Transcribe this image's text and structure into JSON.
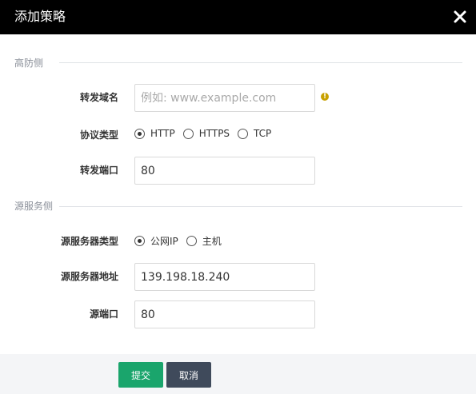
{
  "dialog": {
    "title": "添加策略",
    "close_icon": "close-icon"
  },
  "sections": {
    "frontend_label": "高防侧",
    "origin_label": "源服务侧"
  },
  "fields": {
    "forward_domain": {
      "label": "转发域名",
      "value": "",
      "placeholder": "例如: www.example.com",
      "hint_icon": "warning-icon"
    },
    "protocol_type": {
      "label": "协议类型",
      "options": [
        "HTTP",
        "HTTPS",
        "TCP"
      ],
      "selected": "HTTP"
    },
    "forward_port": {
      "label": "转发端口",
      "value": "80"
    },
    "origin_server_type": {
      "label": "源服务器类型",
      "options": [
        "公网IP",
        "主机"
      ],
      "selected": "公网IP"
    },
    "origin_server_address": {
      "label": "源服务器地址",
      "value": "139.198.18.240"
    },
    "origin_port": {
      "label": "源端口",
      "value": "80"
    }
  },
  "buttons": {
    "submit": "提交",
    "cancel": "取消"
  },
  "colors": {
    "titlebar": "#000000",
    "submit": "#1aa56c",
    "cancel": "#3f4a5b",
    "footer": "#f4f5f7",
    "warning": "#c8a100"
  }
}
